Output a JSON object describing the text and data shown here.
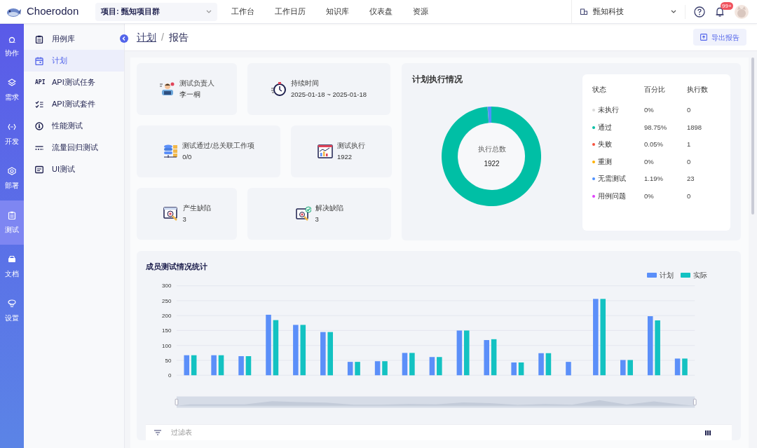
{
  "app": {
    "name": "Choerodon"
  },
  "project_select": {
    "value": "项目: 甄知项目群"
  },
  "nav": [
    {
      "label": "工作台"
    },
    {
      "label": "工作日历"
    },
    {
      "label": "知识库"
    },
    {
      "label": "仪表盘"
    },
    {
      "label": "资源"
    }
  ],
  "org_select": {
    "value": "甄知科技"
  },
  "notifications": {
    "badge": "99+"
  },
  "rail": [
    {
      "label": "协作",
      "selected": false
    },
    {
      "label": "需求",
      "selected": false
    },
    {
      "label": "开发",
      "selected": false
    },
    {
      "label": "部署",
      "selected": false
    },
    {
      "label": "测试",
      "selected": true
    },
    {
      "label": "文档",
      "selected": false
    },
    {
      "label": "设置",
      "selected": false
    }
  ],
  "sidebar": {
    "items": [
      {
        "label": "用例库",
        "kind": "clipboard",
        "selected": false
      },
      {
        "label": "计划",
        "kind": "calendar",
        "selected": true
      },
      {
        "label": "API测试任务",
        "kind": "text",
        "icon_text": "API",
        "selected": false
      },
      {
        "label": "API测试套件",
        "kind": "checklist",
        "selected": false
      },
      {
        "label": "性能测试",
        "kind": "gauge",
        "selected": false
      },
      {
        "label": "流量回归测试",
        "kind": "dashes",
        "selected": false
      },
      {
        "label": "UI测试",
        "kind": "screen",
        "selected": false
      }
    ]
  },
  "breadcrumb": {
    "parent": "计划",
    "separator": "/",
    "current": "报告"
  },
  "export_button": {
    "label": "导出报告"
  },
  "stats": [
    {
      "kind": "person",
      "label": "测试负责人",
      "value": "李一桐"
    },
    {
      "kind": "stopwatch",
      "label": "持续时间",
      "value": "2025-01-18 ~ 2025-01-18"
    },
    {
      "kind": "database",
      "label": "测试通过/总关联工作项",
      "value": "0/0"
    },
    {
      "kind": "chart",
      "label": "测试执行",
      "value": "1922"
    },
    {
      "kind": "bug",
      "label": "产生缺陷",
      "value": "3"
    },
    {
      "kind": "bug_checked",
      "label": "解决缺陷",
      "value": "3"
    }
  ],
  "execution": {
    "title": "计划执行情况",
    "center_label": "执行总数",
    "center_value": "1922",
    "columns": [
      "状态",
      "百分比",
      "执行数"
    ],
    "rows": [
      {
        "status": "未执行",
        "percent": "0%",
        "count": "0",
        "color": "#d9d9d9"
      },
      {
        "status": "通过",
        "percent": "98.75%",
        "count": "1898",
        "color": "#00bfa5"
      },
      {
        "status": "失败",
        "percent": "0.05%",
        "count": "1",
        "color": "#f5523f"
      },
      {
        "status": "重测",
        "percent": "0%",
        "count": "0",
        "color": "#ffb100"
      },
      {
        "status": "无需测试",
        "percent": "1.19%",
        "count": "23",
        "color": "#4d90fe"
      },
      {
        "status": "用例问题",
        "percent": "0%",
        "count": "0",
        "color": "#e040fb"
      }
    ]
  },
  "member_chart": {
    "title": "成员测试情况统计",
    "chart_data": {
      "type": "bar",
      "grid": true,
      "legend": true,
      "ylim": [
        0,
        300
      ],
      "yticks": [
        0,
        50,
        100,
        150,
        200,
        250,
        300
      ],
      "series": [
        {
          "name": "计划",
          "color": "#5b8ff9",
          "values": [
            67,
            67,
            64,
            203,
            169,
            145,
            45,
            47,
            75,
            61,
            150,
            118,
            43,
            74,
            45,
            256,
            51,
            198,
            56
          ]
        },
        {
          "name": "实际",
          "color": "#13c2c2",
          "values": [
            67,
            67,
            64,
            185,
            169,
            145,
            45,
            47,
            75,
            61,
            150,
            121,
            43,
            74,
            null,
            256,
            51,
            184,
            56
          ]
        }
      ]
    }
  },
  "filter": {
    "placeholder": "过滤表"
  }
}
